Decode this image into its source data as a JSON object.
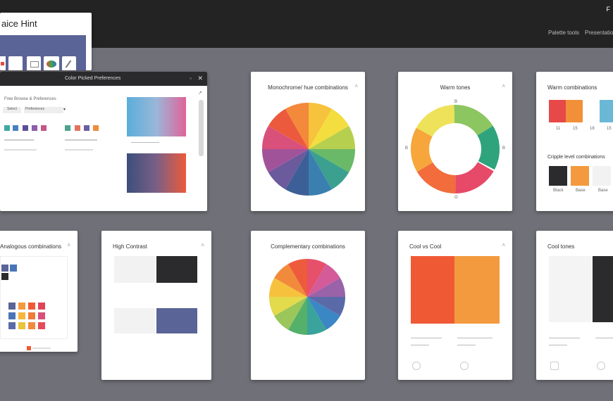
{
  "header": {
    "corner_label": "F",
    "tabs": [
      "Palette tools",
      "Presentations"
    ]
  },
  "hint_window": {
    "title": "aice Hint"
  },
  "palette_window": {
    "title": "Color Picked Preferences",
    "subtitle": "Free Browse & Preferences",
    "dropdown_1": "Select",
    "dropdown_2": "Preferences"
  },
  "cards": {
    "monochrome": {
      "title": "Monochrome/ hue combinations"
    },
    "warm": {
      "title": "Warm tones",
      "labels": [
        "B",
        "B",
        "B",
        "O"
      ]
    },
    "contrast": {
      "title": "Warm combinations",
      "second_title": "Cripple level combinations",
      "swatch_labels": [
        "11",
        "15",
        "18",
        "15"
      ],
      "second_labels": [
        "Black",
        "Base",
        "Base"
      ]
    },
    "analogous": {
      "title": "Analogous combinations"
    },
    "high_contrast": {
      "title": "High Contrast"
    },
    "complementary": {
      "title": "Complementary combinations"
    },
    "cool": {
      "title": "Cool vs Cool"
    },
    "cool_tones": {
      "title": "Cool tones"
    }
  },
  "colors": {
    "topbar": "#232323",
    "bg": "#707078",
    "dark": "#2b2b2e",
    "navy": "#5b6496",
    "orange_red": "#ef5a35",
    "orange": "#f39a3e"
  }
}
